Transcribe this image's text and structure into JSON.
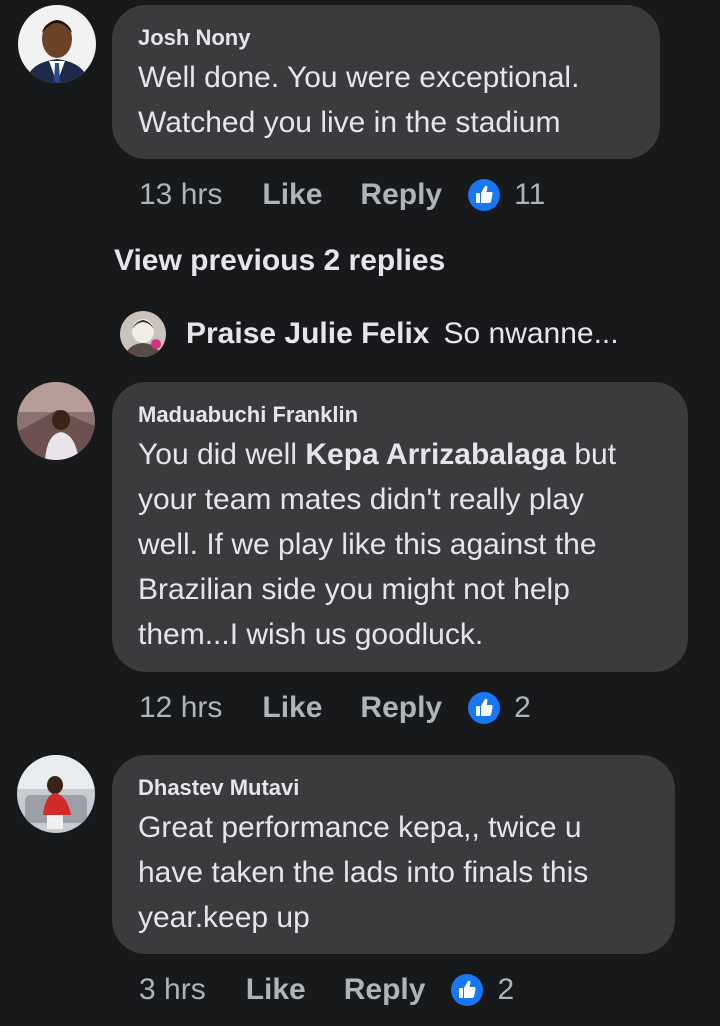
{
  "colors": {
    "background": "#18191a",
    "bubble": "#3a3b3c",
    "text_primary": "#e4e6eb",
    "text_secondary": "#b0b3b8",
    "like_blue": "#1877f2"
  },
  "comments": [
    {
      "author": "Josh Nony",
      "lines": [
        "Well done. You were exceptional.",
        "Watched you live in the stadium"
      ],
      "time": "13 hrs",
      "like_label": "Like",
      "reply_label": "Reply",
      "reaction_icon": "thumbs-up-icon",
      "reaction_count": "11"
    },
    {
      "author": "Maduabuchi Franklin",
      "line1_prefix": "You did well ",
      "mention": "Kepa Arrizabalaga",
      "line1_suffix": " but",
      "lines_rest": [
        "your team mates didn't really play",
        "well. If we play like this against the",
        "Brazilian side you might not help",
        "them...I wish us goodluck."
      ],
      "time": "12 hrs",
      "like_label": "Like",
      "reply_label": "Reply",
      "reaction_icon": "thumbs-up-icon",
      "reaction_count": "2"
    },
    {
      "author": "Dhastev Mutavi",
      "lines": [
        "Great performance kepa,, twice u",
        "have taken the lads into finals this",
        "year.keep up"
      ],
      "time": "3 hrs",
      "like_label": "Like",
      "reply_label": "Reply",
      "reaction_icon": "thumbs-up-icon",
      "reaction_count": "2"
    }
  ],
  "view_previous": "View previous 2 replies",
  "reply_preview": {
    "name": "Praise Julie Felix",
    "snippet": "So nwanne..."
  }
}
